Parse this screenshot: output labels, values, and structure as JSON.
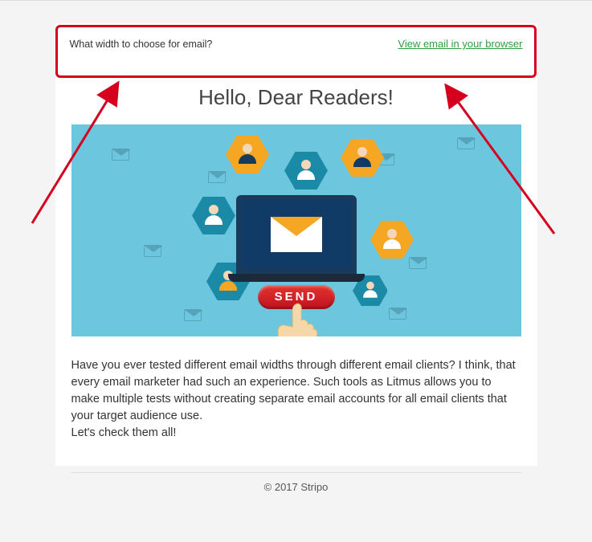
{
  "preheader": {
    "subject": "What width to choose for email?",
    "view_link": "View email in your browser"
  },
  "title": "Hello, Dear Readers!",
  "hero": {
    "send_label": "SEND"
  },
  "body": {
    "paragraph": "Have you ever tested different email widths through different email clients? I think, that every email marketer had such an experience. Such tools as Litmus allows you to make multiple tests without creating separate email accounts for all email clients that your target audience use.",
    "cta": "Let's check them all!"
  },
  "footer": "© 2017 Stripo",
  "annotation": {
    "highlight_color": "#d4001e"
  }
}
